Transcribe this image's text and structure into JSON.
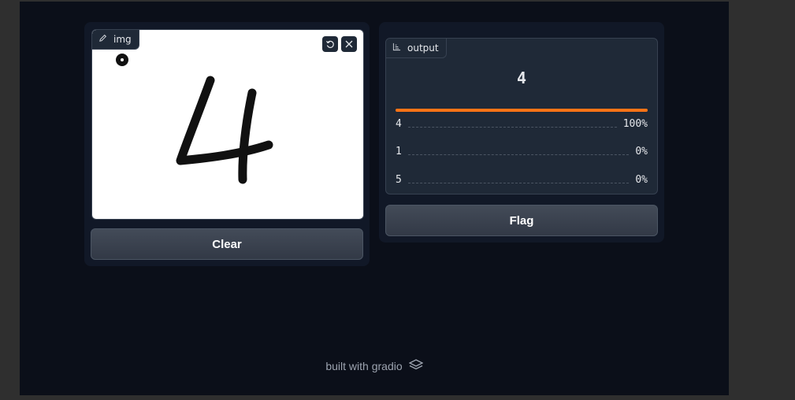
{
  "input": {
    "label": "img",
    "drawn_digit_hint": "handwritten digit",
    "buttons": {
      "undo_icon": "undo-icon",
      "clear_canvas_icon": "close-icon"
    },
    "clear_label": "Clear"
  },
  "output": {
    "label": "output",
    "predicted": "4",
    "top_confidence": 1.0,
    "confidences": [
      {
        "label": "4",
        "value": "100%"
      },
      {
        "label": "1",
        "value": "0%"
      },
      {
        "label": "5",
        "value": "0%"
      }
    ],
    "flag_label": "Flag"
  },
  "footer": {
    "text": "built with gradio"
  },
  "colors": {
    "accent": "#f97316",
    "background": "#0b0f19",
    "panel": "#111827"
  }
}
